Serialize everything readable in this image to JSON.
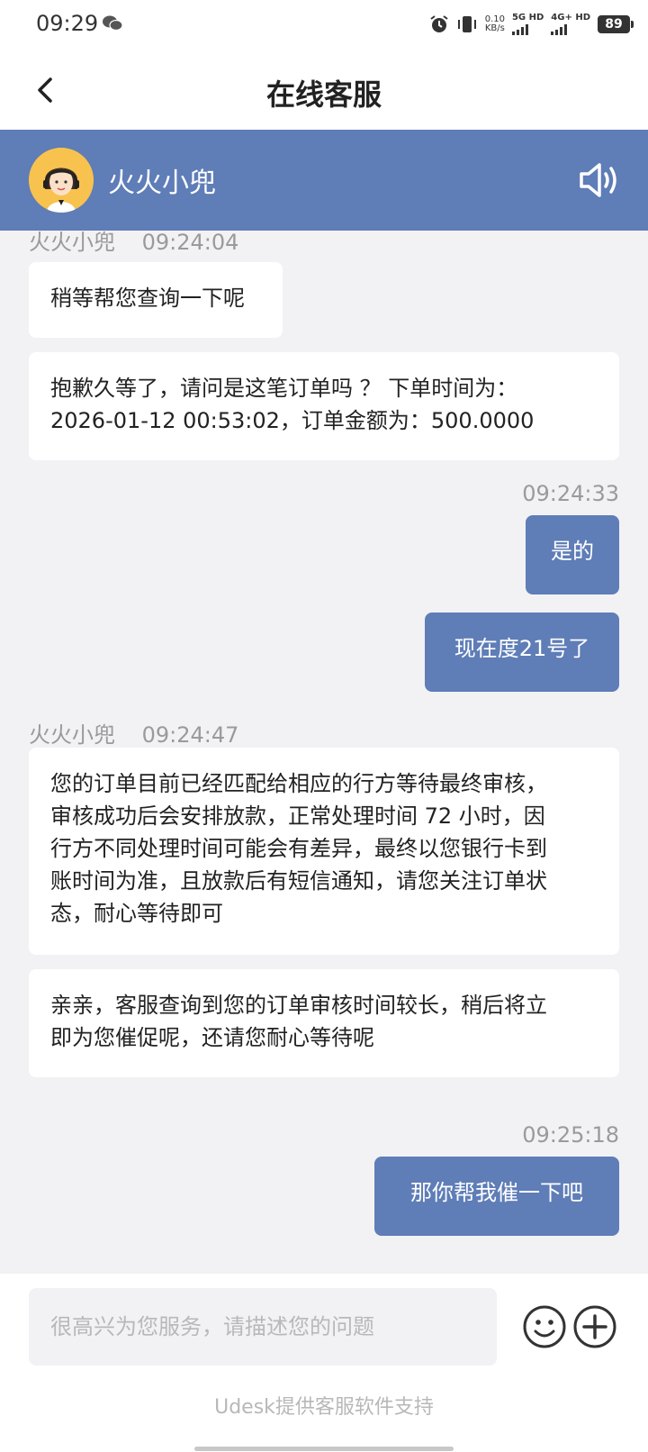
{
  "status_bar": {
    "time": "09:29",
    "speed_value": "0.10",
    "speed_unit": "KB/s",
    "net1": "5G HD",
    "net2": "4G+ HD",
    "battery": "89",
    "icons": [
      "wechat-icon",
      "alarm-icon",
      "vibrate-icon",
      "signal-icon",
      "battery-icon"
    ]
  },
  "nav": {
    "title": "在线客服",
    "back_icon": "chevron-left-icon"
  },
  "agent": {
    "name": "火火小兜",
    "speaker_icon": "speaker-icon",
    "color": "#5f7db7"
  },
  "messages": [
    {
      "from": "agent",
      "sender": "火火小兜",
      "time": "09:24:04"
    },
    {
      "from": "agent",
      "text": "稍等帮您查询一下呢"
    },
    {
      "from": "agent",
      "lines": [
        "抱歉久等了，请问是这笔订单吗 ？ 下单时间为：",
        "2026-01-12 00:53:02，订单金额为：500.0000"
      ]
    },
    {
      "from": "user",
      "time": "09:24:33"
    },
    {
      "from": "user",
      "text": "是的"
    },
    {
      "from": "user",
      "text": "现在度21号了"
    },
    {
      "from": "agent",
      "sender": "火火小兜",
      "time": "09:24:47"
    },
    {
      "from": "agent",
      "lines": [
        "您的订单目前已经匹配给相应的行方等待最终审核，",
        "审核成功后会安排放款，正常处理时间 72 小时，因",
        "行方不同处理时间可能会有差异，最终以您银行卡到",
        "账时间为准，且放款后有短信通知，请您关注订单状",
        "态，耐心等待即可"
      ]
    },
    {
      "from": "agent",
      "lines": [
        "亲亲，客服查询到您的订单审核时间较长，稍后将立",
        "即为您催促呢，还请您耐心等待呢"
      ]
    },
    {
      "from": "user",
      "time": "09:25:18"
    },
    {
      "from": "user",
      "text": "那你帮我催一下吧"
    }
  ],
  "input": {
    "placeholder": "很高兴为您服务，请描述您的问题",
    "value": "",
    "emoji_icon": "emoji-icon",
    "plus_icon": "plus-circle-icon"
  },
  "footer": {
    "powered": "Udesk提供客服软件支持"
  }
}
